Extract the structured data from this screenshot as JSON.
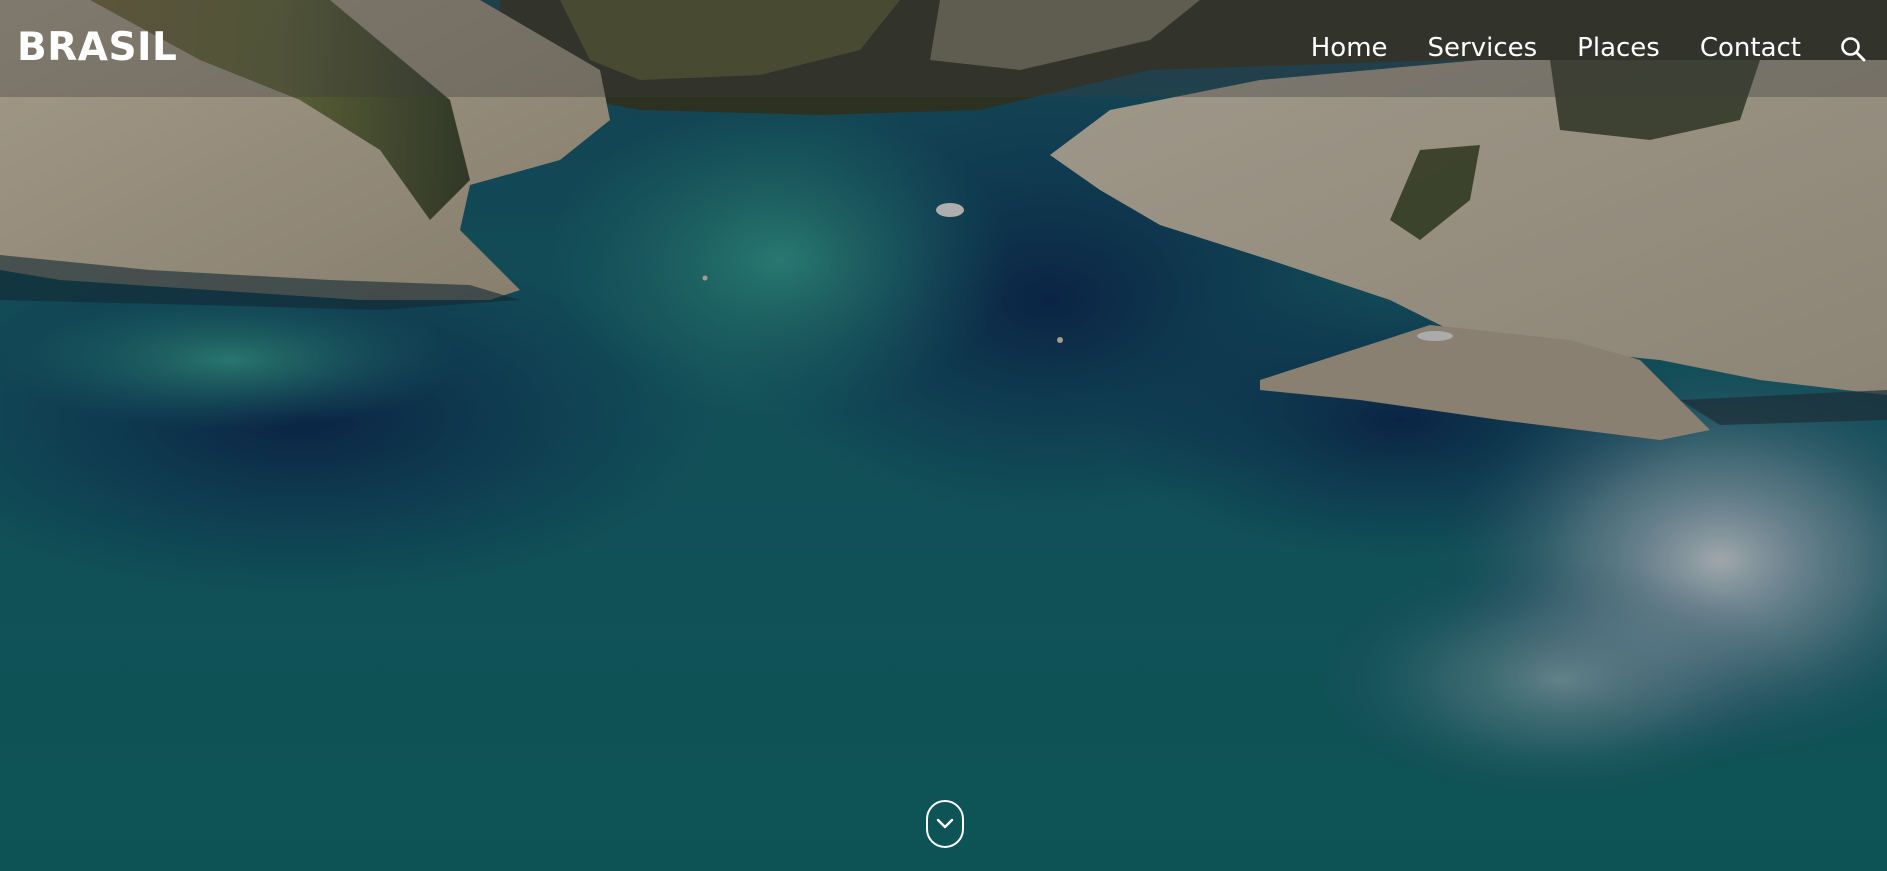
{
  "site": {
    "brand": "BRASIL"
  },
  "nav": {
    "items": [
      {
        "label": "Home"
      },
      {
        "label": "Services"
      },
      {
        "label": "Places"
      },
      {
        "label": "Contact"
      }
    ],
    "search_icon": "search-icon"
  },
  "hero": {
    "background": "aerial photo of turquoise bay with white limestone cliffs",
    "scroll_icon": "chevron-down-icon"
  },
  "colors": {
    "nav_text": "#ffffff",
    "nav_bg": "rgba(60,60,60,0.35)",
    "water_deep": "#123e63",
    "water_turquoise": "#1f8d8a",
    "cliff": "#d9cdb6"
  }
}
